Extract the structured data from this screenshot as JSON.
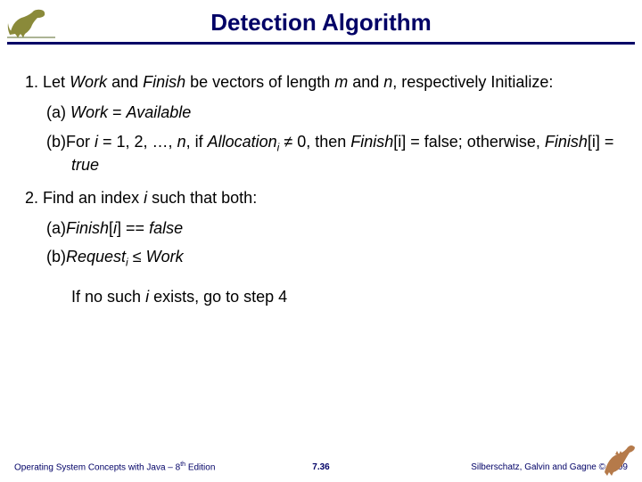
{
  "slide": {
    "title": "Detection Algorithm"
  },
  "content": {
    "step1": {
      "num": "1.",
      "prefix": "Let ",
      "work": "Work",
      "and1": " and ",
      "finish": "Finish",
      "mid": " be vectors of length ",
      "m": "m",
      "and2": " and ",
      "n": "n",
      "suffix": ", respectively Initialize:"
    },
    "step1a": {
      "label": "(a) ",
      "work": "Work",
      "eq": " = ",
      "avail": "Available"
    },
    "step1b": {
      "label": "(b)",
      "for": "For ",
      "i": "i",
      "range": " = 1, 2, …, ",
      "n": "n",
      "if": ", if ",
      "alloc": "Allocation",
      "sub_i": "i",
      "neq": " ≠ 0, then ",
      "finish_i": "Finish",
      "bracket1": "[i] = false; otherwise, ",
      "finish_i2": "Finish",
      "bracket2": "[i] = ",
      "true": "true"
    },
    "step2": {
      "num": "2.",
      "text1": "Find an index ",
      "i": "i",
      "text2": " such that both:"
    },
    "step2a": {
      "label": "(a)",
      "finish": "Finish",
      "open": "[",
      "i": "i",
      "close": "] == ",
      "false": "false"
    },
    "step2b": {
      "label": "(b)",
      "request": "Request",
      "sub_i": "i",
      "le": " ≤ ",
      "work": "Work"
    },
    "step2c": {
      "text1": "If no such ",
      "i": "i",
      "text2": " exists, go to step 4"
    }
  },
  "footer": {
    "left_pre": "Operating System Concepts  with Java – 8",
    "left_sup": "th",
    "left_post": " Edition",
    "center": "7.36",
    "right": "Silberschatz, Galvin and Gagne © 2009"
  }
}
